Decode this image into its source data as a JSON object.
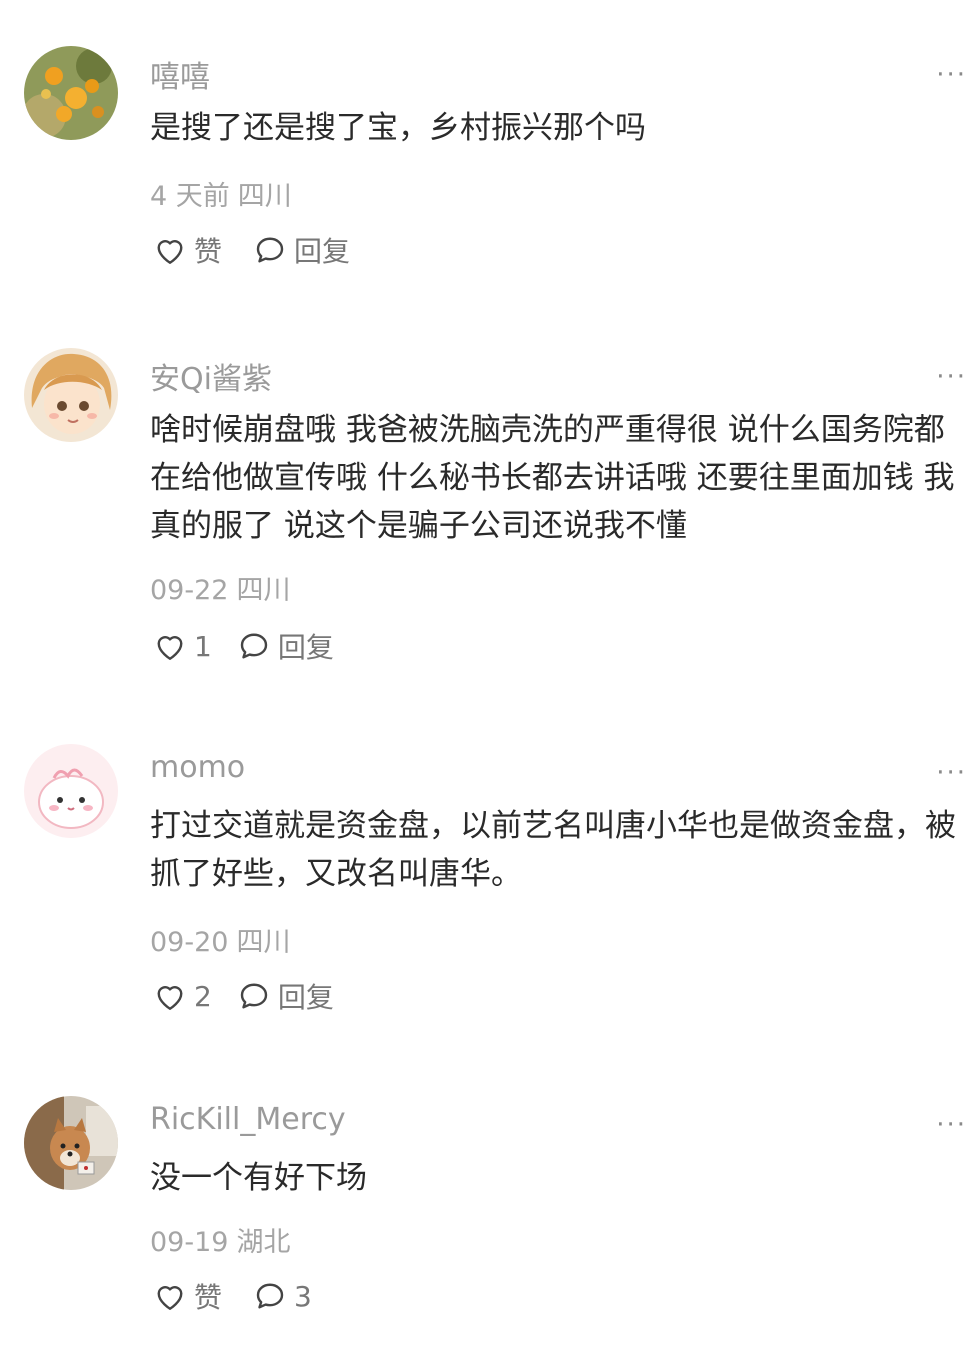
{
  "comments": [
    {
      "username": "嘻嘻",
      "text": "是搜了还是搜了宝，乡村振兴那个吗",
      "time": "4 天前",
      "location": "四川",
      "like_label": "赞",
      "reply_label": "回复",
      "more": "···"
    },
    {
      "username": "安Qi酱紫",
      "text": "啥时候崩盘哦 我爸被洗脑壳洗的严重得很 说什么国务院都在给他做宣传哦 什么秘书长都去讲话哦 还要往里面加钱 我真的服了 说这个是骗子公司还说我不懂",
      "time": "09-22",
      "location": "四川",
      "like_label": "1",
      "reply_label": "回复",
      "more": "···"
    },
    {
      "username": "momo",
      "text": "打过交道就是资金盘，以前艺名叫唐小华也是做资金盘，被抓了好些，又改名叫唐华。",
      "time": "09-20",
      "location": "四川",
      "like_label": "2",
      "reply_label": "回复",
      "more": "···"
    },
    {
      "username": "RicKill_Mercy",
      "text": "没一个有好下场",
      "time": "09-19",
      "location": "湖北",
      "like_label": "赞",
      "reply_label": "3",
      "more": "···"
    }
  ],
  "colors": {
    "username": "#9a9a9a",
    "text": "#2a2a2a",
    "meta": "#a5a5a5",
    "action": "#777777"
  }
}
